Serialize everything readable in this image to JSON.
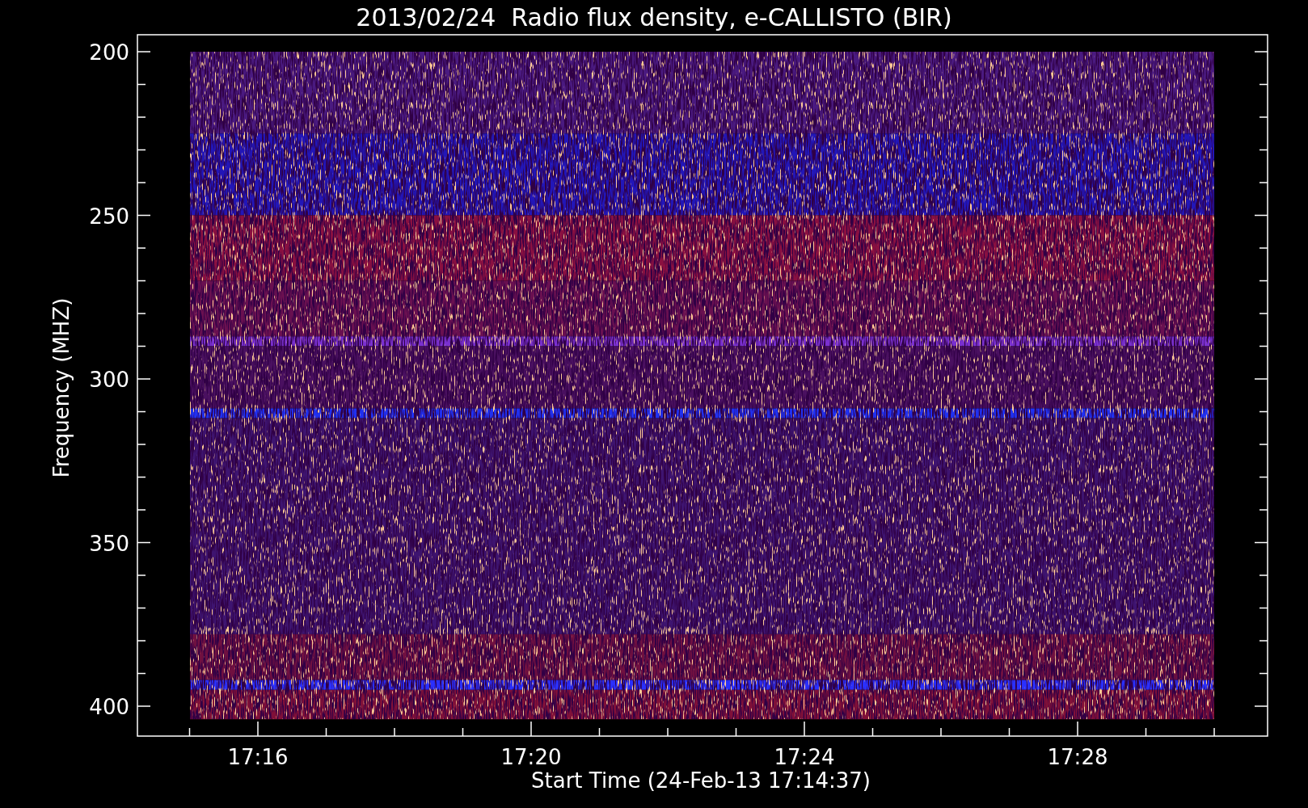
{
  "title": "2013/02/24  Radio flux density, e-CALLISTO (BIR)",
  "ylabel": "Frequency (MHZ)",
  "xlabel": "Start Time (24-Feb-13 17:14:37)",
  "yticks": [
    "200",
    "250",
    "300",
    "350",
    "400"
  ],
  "xticks": [
    "17:16",
    "17:20",
    "17:24",
    "17:28"
  ]
}
